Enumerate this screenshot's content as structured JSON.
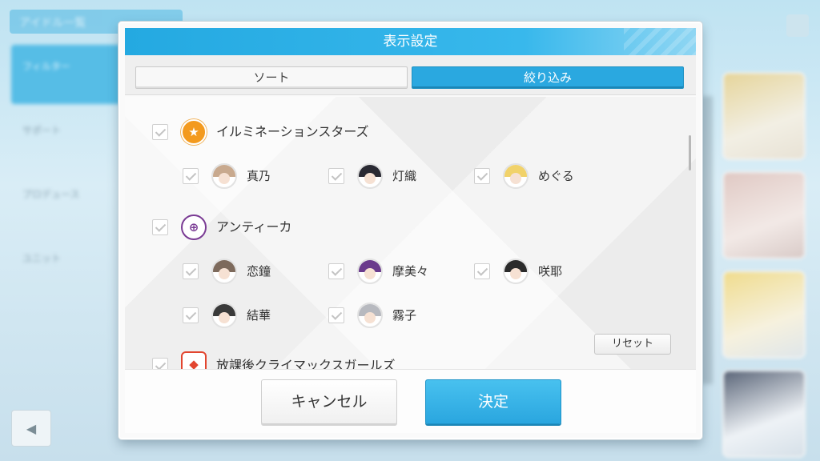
{
  "dialog": {
    "title": "表示設定",
    "tabs": [
      {
        "label": "ソート",
        "active": false
      },
      {
        "label": "絞り込み",
        "active": true
      }
    ]
  },
  "units": [
    {
      "name": "イルミネーションスターズ",
      "icon": "illumination-stars-icon",
      "checked": true,
      "idols": [
        {
          "name": "真乃",
          "checked": true,
          "hair": "#c8a98e"
        },
        {
          "name": "灯織",
          "checked": true,
          "hair": "#2a2a33"
        },
        {
          "name": "めぐる",
          "checked": true,
          "hair": "#f1d26a"
        }
      ]
    },
    {
      "name": "アンティーカ",
      "icon": "antica-icon",
      "checked": true,
      "idols": [
        {
          "name": "恋鐘",
          "checked": true,
          "hair": "#7d6a5c"
        },
        {
          "name": "摩美々",
          "checked": true,
          "hair": "#6a3a8c"
        },
        {
          "name": "咲耶",
          "checked": true,
          "hair": "#2b2b2b"
        },
        {
          "name": "結華",
          "checked": true,
          "hair": "#3a3a3a"
        },
        {
          "name": "霧子",
          "checked": true,
          "hair": "#b7b9bf"
        }
      ]
    },
    {
      "name": "放課後クライマックスガールズ",
      "icon": "houkago-climax-girls-icon",
      "checked": true,
      "idols": []
    }
  ],
  "reset_label": "リセット",
  "footer": {
    "cancel_label": "キャンセル",
    "confirm_label": "決定"
  },
  "colors": {
    "accent": "#2aa8e0",
    "illumination": "#f39a1e",
    "antica": "#7a3b94",
    "houkago": "#e2452f"
  }
}
